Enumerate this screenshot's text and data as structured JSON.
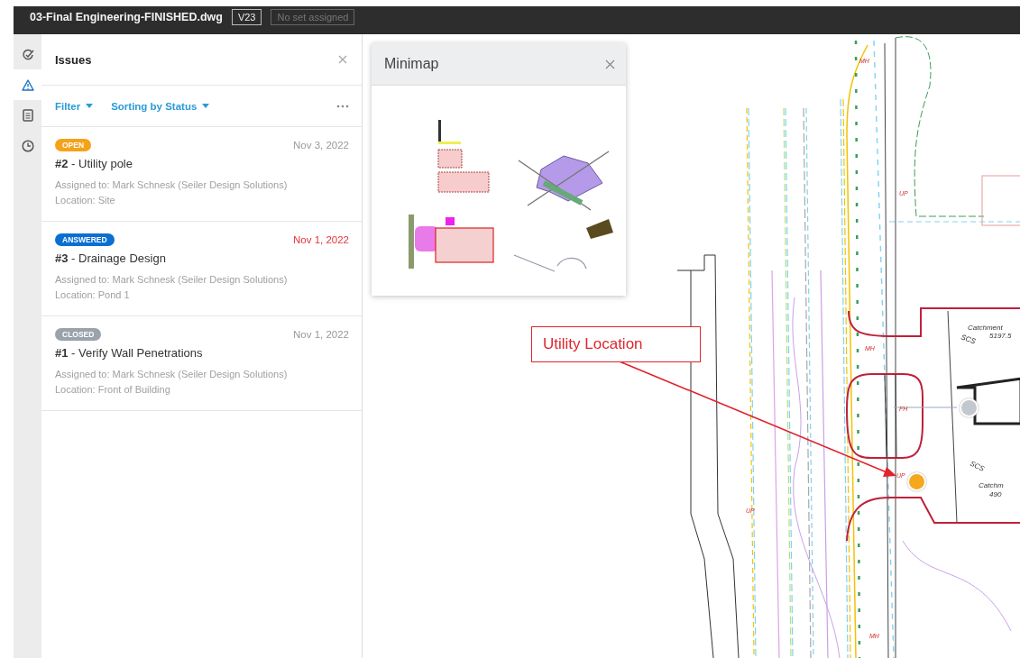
{
  "title_bar": {
    "file_name": "03-Final Engineering-FINISHED.dwg",
    "version": "V23",
    "set_label": "No set assigned"
  },
  "rail": [
    {
      "kind": "markup",
      "selected": false
    },
    {
      "kind": "issues",
      "selected": true
    },
    {
      "kind": "sheets",
      "selected": false
    },
    {
      "kind": "history",
      "selected": false
    }
  ],
  "issues_panel": {
    "title": "Issues",
    "filter": "Filter",
    "sorting": "Sorting by Status",
    "issues": [
      {
        "status": "OPEN",
        "color": "#f5a21b",
        "date": "Nov 3, 2022",
        "overdue": false,
        "number": "#2",
        "title": " - Utility pole",
        "assigned": "Assigned to: Mark Schnesk (Seiler Design Solutions)",
        "location": "Location: Site"
      },
      {
        "status": "ANSWERED",
        "color": "#0a6fd0",
        "date": "Nov 1, 2022",
        "overdue": true,
        "number": "#3",
        "title": " - Drainage Design",
        "assigned": "Assigned to: Mark Schnesk (Seiler Design Solutions)",
        "location": "Location: Pond 1"
      },
      {
        "status": "CLOSED",
        "color": "#9aa2ab",
        "date": "Nov 1, 2022",
        "overdue": false,
        "number": "#1",
        "title": " - Verify Wall Penetrations",
        "assigned": "Assigned to: Mark Schnesk (Seiler Design Solutions)",
        "location": "Location: Front of Building"
      }
    ]
  },
  "minimap": {
    "title": "Minimap"
  },
  "drawing": {
    "callout": "Utility Location",
    "labels": [
      "MH",
      "UP",
      "MH",
      "FH",
      "UP",
      "UP",
      "MH",
      "Catchment",
      "SCS",
      "5197.5",
      "SCS",
      "Catchm",
      "490"
    ],
    "pins": [
      {
        "color": "#c3c8ce"
      },
      {
        "color": "#f5a81c"
      }
    ]
  }
}
